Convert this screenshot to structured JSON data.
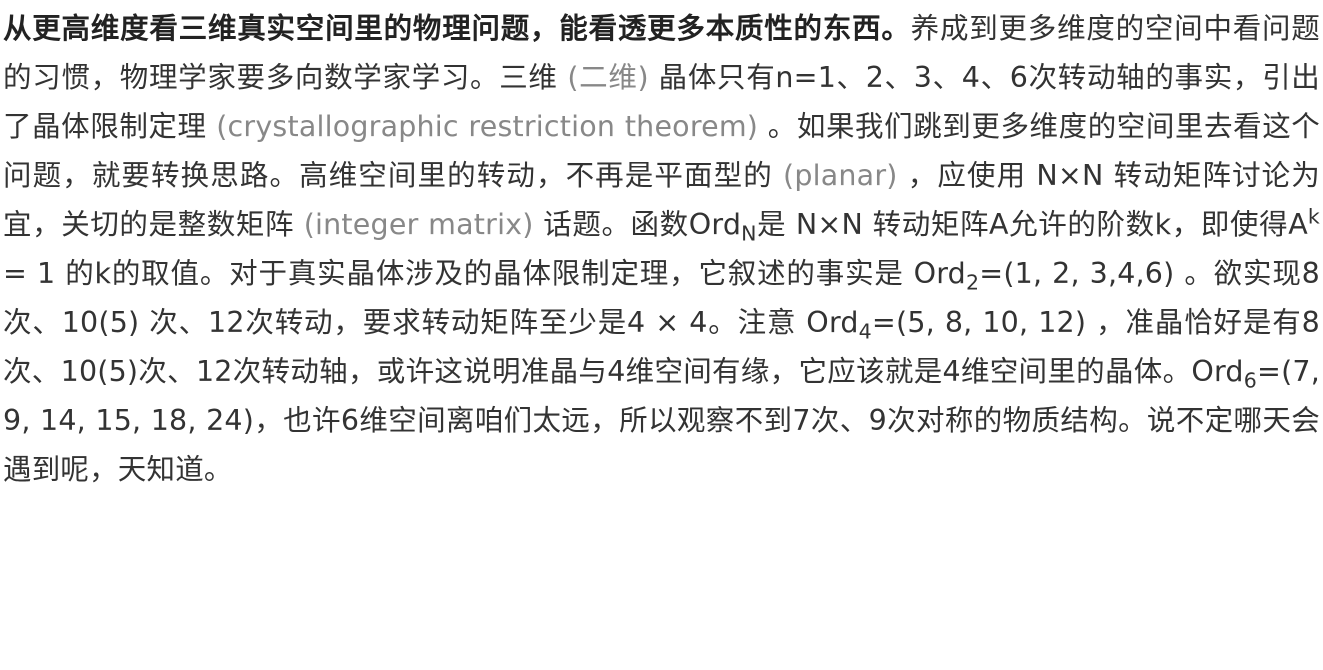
{
  "paragraph": {
    "lead_bold": "从更高维度看三维真实空间里的物理问题，能看透更多本质性的东西。",
    "s1": "养成到更多维度的空间中看问题的习惯，物理学家要多向数学家学习。三维 ",
    "s1_gray": "(二维)",
    "s2": " 晶体只有n=1、2、3、4、6次转动轴的事实，引出了晶体限制定理 ",
    "s2_gray": "(crystallographic restriction theorem)",
    "s3": " 。如果我们跳到更多维度的空间里去看这个问题，就要转换思路。高维空间里的转动，不再是平面型的 ",
    "s3_gray": "(planar)",
    "s4": " ，应使用 N×N 转动矩阵讨论为宜，关切的是整数矩阵 ",
    "s4_gray": "(integer matrix)",
    "s5": " 话题。函数Ord",
    "ord_sub_n": "N",
    "s6": "是 N×N 转动矩阵A允许的阶数k，即使得A",
    "pow_k": "k",
    "s7": " = 1 的k的取值。对于真实晶体涉及的晶体限制定理，它叙述的事实是 Ord",
    "ord2_sub": "2",
    "ord2_vals": "=(1, 2, 3,4,6)",
    "s8": " 。欲实现8次、10(5) 次、12次转动，要求转动矩阵至少是4 × 4。注意 Ord",
    "ord4_sub": "4",
    "ord4_vals": "=(5, 8, 10, 12)",
    "s9": " ，准晶恰好是有8次、10(5)次、12次转动轴，或许这说明准晶与4维空间有缘，它应该就是4维空间里的晶体。Ord",
    "ord6_sub": "6",
    "ord6_vals": "=(7, 9, 14, 15, 18, 24)",
    "s10": "，也许6维空间离咱们太远，所以观察不到7次、9次对称的物质结构。说不定哪天会遇到呢，天知道。"
  }
}
